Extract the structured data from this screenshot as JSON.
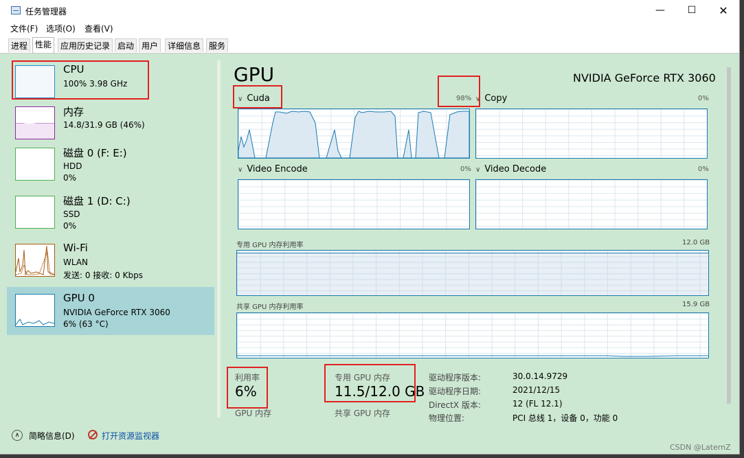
{
  "window": {
    "title": "任务管理器",
    "controls": {
      "minimize": "—",
      "maximize": "☐",
      "close": "✕"
    }
  },
  "menu": [
    "文件(F)",
    "选项(O)",
    "查看(V)"
  ],
  "tabs": [
    "进程",
    "性能",
    "应用历史记录",
    "启动",
    "用户",
    "详细信息",
    "服务"
  ],
  "active_tab": "性能",
  "sidebar": {
    "items": [
      {
        "name": "CPU",
        "line1": "100% 3.98 GHz",
        "line2": ""
      },
      {
        "name": "内存",
        "line1": "14.8/31.9 GB (46%)",
        "line2": ""
      },
      {
        "name": "磁盘 0 (F: E:)",
        "line1": "HDD",
        "line2": "0%"
      },
      {
        "name": "磁盘 1 (D: C:)",
        "line1": "SSD",
        "line2": "0%"
      },
      {
        "name": "Wi-Fi",
        "line1": "WLAN",
        "line2": "发送: 0 接收: 0 Kbps"
      },
      {
        "name": "GPU 0",
        "line1": "NVIDIA GeForce RTX 3060",
        "line2": "6% (63 °C)"
      }
    ],
    "selected": "GPU 0"
  },
  "main": {
    "title": "GPU",
    "model": "NVIDIA GeForce RTX 3060",
    "engines": [
      {
        "name": "Cuda",
        "percent": "98%"
      },
      {
        "name": "Copy",
        "percent": "0%"
      },
      {
        "name": "Video Encode",
        "percent": "0%"
      },
      {
        "name": "Video Decode",
        "percent": "0%"
      }
    ],
    "dedicated_mem_graph": {
      "label": "专用 GPU 内存利用率",
      "max": "12.0 GB"
    },
    "shared_mem_graph": {
      "label": "共享 GPU 内存利用率",
      "max": "15.9 GB"
    },
    "stats": {
      "utilization_label": "利用率",
      "utilization_value": "6%",
      "gpu_mem_label": "GPU 内存",
      "dedicated_label": "专用 GPU 内存",
      "dedicated_value": "11.5/12.0 GB",
      "shared_label": "共享 GPU 内存"
    },
    "driver": [
      {
        "label": "驱动程序版本:",
        "value": "30.0.14.9729"
      },
      {
        "label": "驱动程序日期:",
        "value": "2021/12/15"
      },
      {
        "label": "DirectX 版本:",
        "value": "12 (FL 12.1)"
      },
      {
        "label": "物理位置:",
        "value": "PCI 总线 1，设备 0，功能 0"
      }
    ]
  },
  "footer": {
    "fewer_details": "简略信息(D)",
    "open_resmon": "打开资源监视器"
  },
  "watermark": "CSDN @LaternZ",
  "colors": {
    "window_bg": "#cde8d2",
    "selection": "#a7d4d6",
    "gpu_line": "#1a7ab0",
    "cpu": "#1f8bd1",
    "memory": "#8b2a9c",
    "disk": "#4caf50",
    "wifi": "#a85a10",
    "highlight": "#e02020"
  }
}
